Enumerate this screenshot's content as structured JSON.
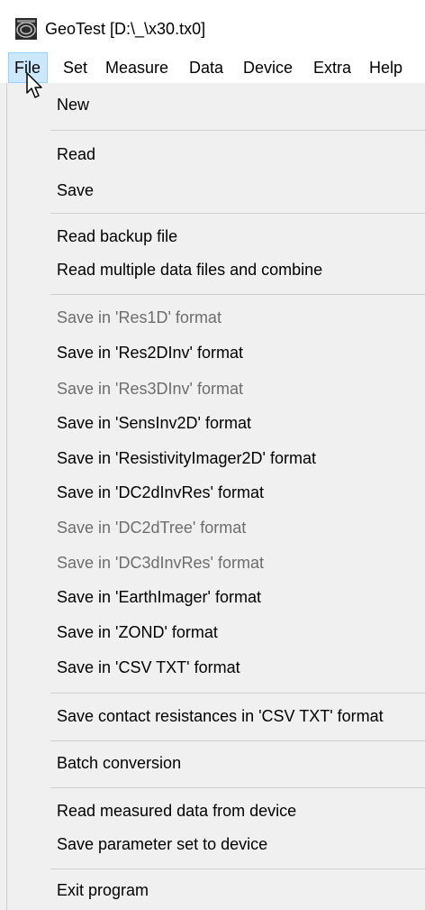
{
  "window": {
    "title": "GeoTest [D:\\_\\x30.tx0]"
  },
  "menubar": {
    "items": [
      {
        "label": "File",
        "active": true
      },
      {
        "label": "Set"
      },
      {
        "label": "Measure"
      },
      {
        "label": "Data"
      },
      {
        "label": "Device"
      },
      {
        "label": "Extra"
      },
      {
        "label": "Help"
      }
    ]
  },
  "file_menu": {
    "items": [
      {
        "label": "New",
        "enabled": true
      },
      {
        "label": "Read",
        "enabled": true
      },
      {
        "label": "Save",
        "enabled": true
      },
      {
        "label": "Read backup file",
        "enabled": true
      },
      {
        "label": "Read multiple data files and combine",
        "enabled": true
      },
      {
        "label": "Save in 'Res1D' format",
        "enabled": false
      },
      {
        "label": "Save in 'Res2DInv' format",
        "enabled": true
      },
      {
        "label": "Save in 'Res3DInv' format",
        "enabled": false
      },
      {
        "label": "Save in 'SensInv2D' format",
        "enabled": true
      },
      {
        "label": "Save in 'ResistivityImager2D' format",
        "enabled": true
      },
      {
        "label": "Save in 'DC2dInvRes' format",
        "enabled": true
      },
      {
        "label": "Save in 'DC2dTree' format",
        "enabled": false
      },
      {
        "label": "Save in 'DC3dInvRes' format",
        "enabled": false
      },
      {
        "label": "Save in 'EarthImager' format",
        "enabled": true
      },
      {
        "label": "Save in 'ZOND' format",
        "enabled": true
      },
      {
        "label": "Save in 'CSV TXT' format",
        "enabled": true
      },
      {
        "label": "Save contact resistances in 'CSV TXT' format",
        "enabled": true
      },
      {
        "label": "Batch conversion",
        "enabled": true
      },
      {
        "label": "Read measured data from device",
        "enabled": true
      },
      {
        "label": "Save parameter set to device",
        "enabled": true
      },
      {
        "label": "Exit program",
        "enabled": true
      }
    ]
  },
  "colors": {
    "menu_highlight": "#cce8ff",
    "disabled_text": "#6d6d6d",
    "menu_background": "#f0f0f0"
  },
  "icons": {
    "app": "geotest-app-icon",
    "cursor": "mouse-pointer-icon"
  }
}
